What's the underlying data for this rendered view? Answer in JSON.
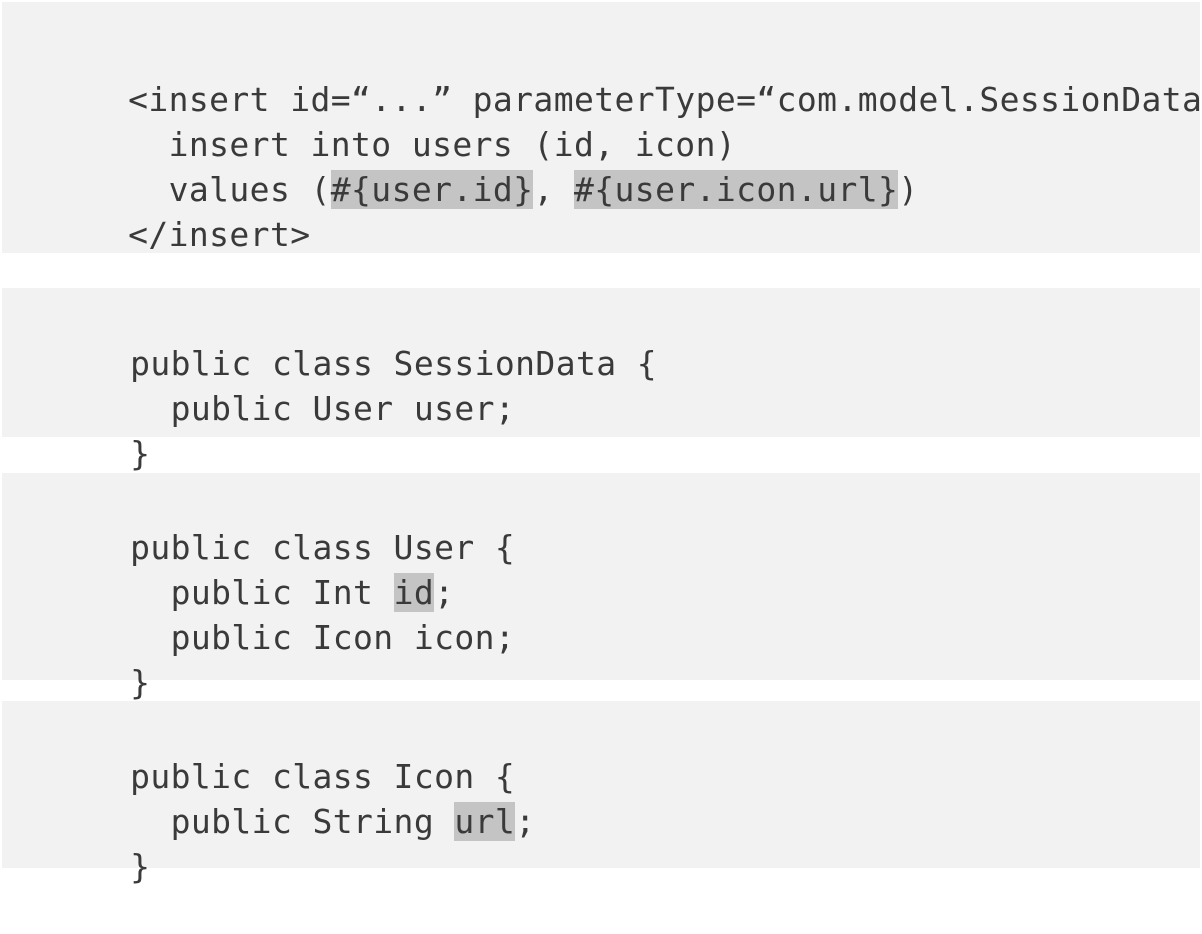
{
  "blocks": [
    {
      "lines": [
        [
          {
            "t": "<insert id=“...” parameterType=“com.model.SessionData”>"
          }
        ],
        [
          {
            "t": "  insert into users (id, icon)"
          }
        ],
        [
          {
            "t": "  values ("
          },
          {
            "t": "#{user.id}",
            "hl": true
          },
          {
            "t": ", "
          },
          {
            "t": "#{user.icon.url}",
            "hl": true
          },
          {
            "t": ")"
          }
        ],
        [
          {
            "t": "</insert>"
          }
        ]
      ]
    },
    {
      "lines": [
        [
          {
            "t": "public class SessionData {"
          }
        ],
        [
          {
            "t": "  public User user;"
          }
        ],
        [
          {
            "t": "}"
          }
        ]
      ]
    },
    {
      "lines": [
        [
          {
            "t": "public class User {"
          }
        ],
        [
          {
            "t": "  public Int "
          },
          {
            "t": "id",
            "hl": true
          },
          {
            "t": ";"
          }
        ],
        [
          {
            "t": "  public Icon icon;"
          }
        ],
        [
          {
            "t": "}"
          }
        ]
      ]
    },
    {
      "lines": [
        [
          {
            "t": "public class Icon {"
          }
        ],
        [
          {
            "t": "  public String "
          },
          {
            "t": "url",
            "hl": true
          },
          {
            "t": ";"
          }
        ],
        [
          {
            "t": "}"
          }
        ]
      ]
    }
  ],
  "colors": {
    "block_background": "#f2f2f2",
    "highlight": "#c4c4c4",
    "text": "#3a3a3a"
  }
}
